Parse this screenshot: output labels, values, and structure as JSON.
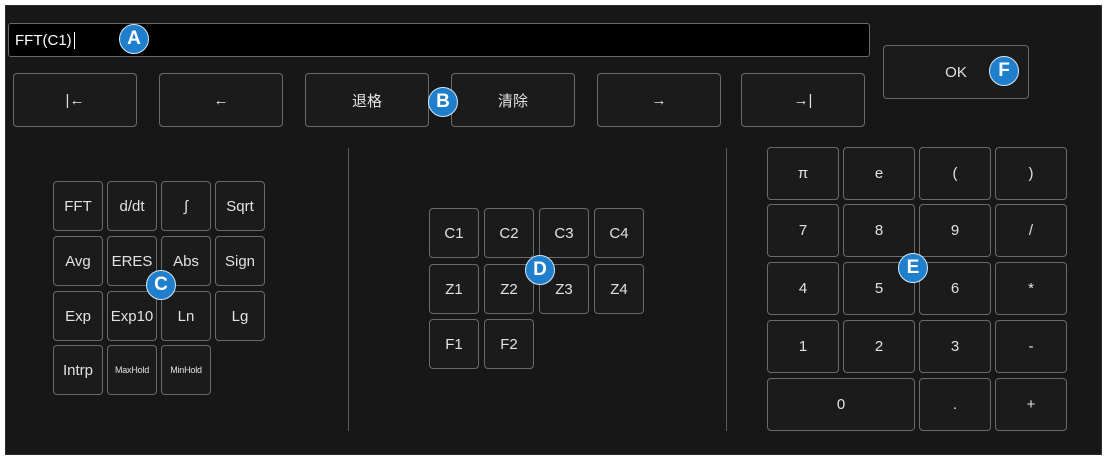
{
  "expression": {
    "value": "FFT(C1)"
  },
  "nav_row": [
    "|←",
    "←",
    "退格",
    "清除",
    "→",
    "→|"
  ],
  "ok_label": "OK",
  "functions": [
    [
      "FFT",
      "d/dt",
      "∫",
      "Sqrt"
    ],
    [
      "Avg",
      "ERES",
      "Abs",
      "Sign"
    ],
    [
      "Exp",
      "Exp10",
      "Ln",
      "Lg"
    ],
    [
      "Intrp",
      "MaxHold",
      "MinHold"
    ]
  ],
  "sources": [
    [
      "C1",
      "C2",
      "C3",
      "C4"
    ],
    [
      "Z1",
      "Z2",
      "Z3",
      "Z4"
    ],
    [
      "F1",
      "F2"
    ]
  ],
  "keypad": [
    [
      "π",
      "e",
      "(",
      ")"
    ],
    [
      "7",
      "8",
      "9",
      "/"
    ],
    [
      "4",
      "5",
      "6",
      "*"
    ],
    [
      "1",
      "2",
      "3",
      "-"
    ],
    [
      "0",
      ".",
      "+"
    ]
  ],
  "callouts": [
    "A",
    "B",
    "C",
    "D",
    "E",
    "F"
  ],
  "colors": {
    "callout": "#1f7fcc",
    "panel": "#171717",
    "key_border": "#6a6a6a"
  }
}
